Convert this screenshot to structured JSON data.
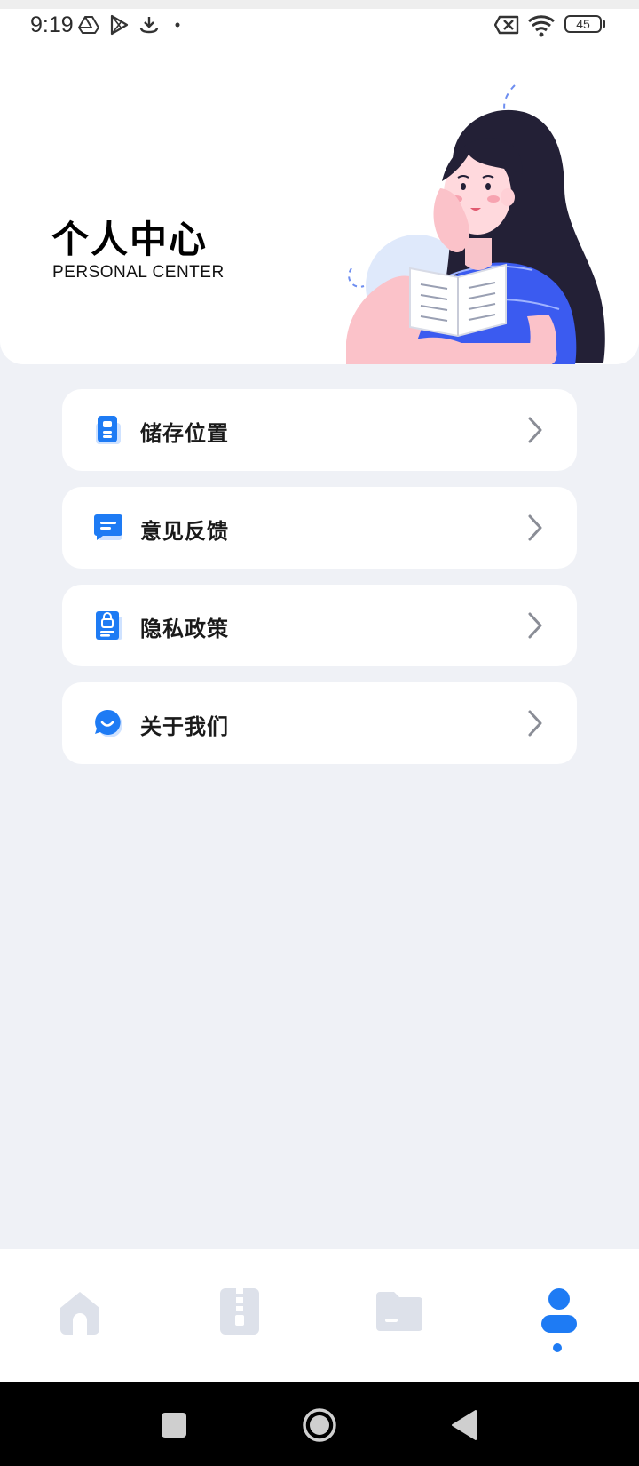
{
  "status_bar": {
    "time": "9:19",
    "battery": "45",
    "icons": [
      "drive-icon",
      "play-store-icon",
      "download-icon",
      "dot-icon",
      "no-sim-icon",
      "wifi-icon",
      "battery-icon"
    ]
  },
  "header": {
    "title": "个人中心",
    "subtitle": "PERSONAL CENTER",
    "illustration": "girl-reading-book-illustration"
  },
  "menu": {
    "items": [
      {
        "label": "储存位置",
        "icon": "storage-icon"
      },
      {
        "label": "意见反馈",
        "icon": "feedback-icon"
      },
      {
        "label": "隐私政策",
        "icon": "privacy-icon"
      },
      {
        "label": "关于我们",
        "icon": "about-icon"
      }
    ]
  },
  "bottom_nav": {
    "tabs": [
      {
        "icon": "home-icon",
        "active": false
      },
      {
        "icon": "zip-file-icon",
        "active": false
      },
      {
        "icon": "folder-icon",
        "active": false
      },
      {
        "icon": "profile-icon",
        "active": true
      }
    ]
  },
  "colors": {
    "accent": "#1e7bf4",
    "background": "#eff1f6",
    "card": "#ffffff",
    "inactive_icon": "#dde1ea"
  }
}
